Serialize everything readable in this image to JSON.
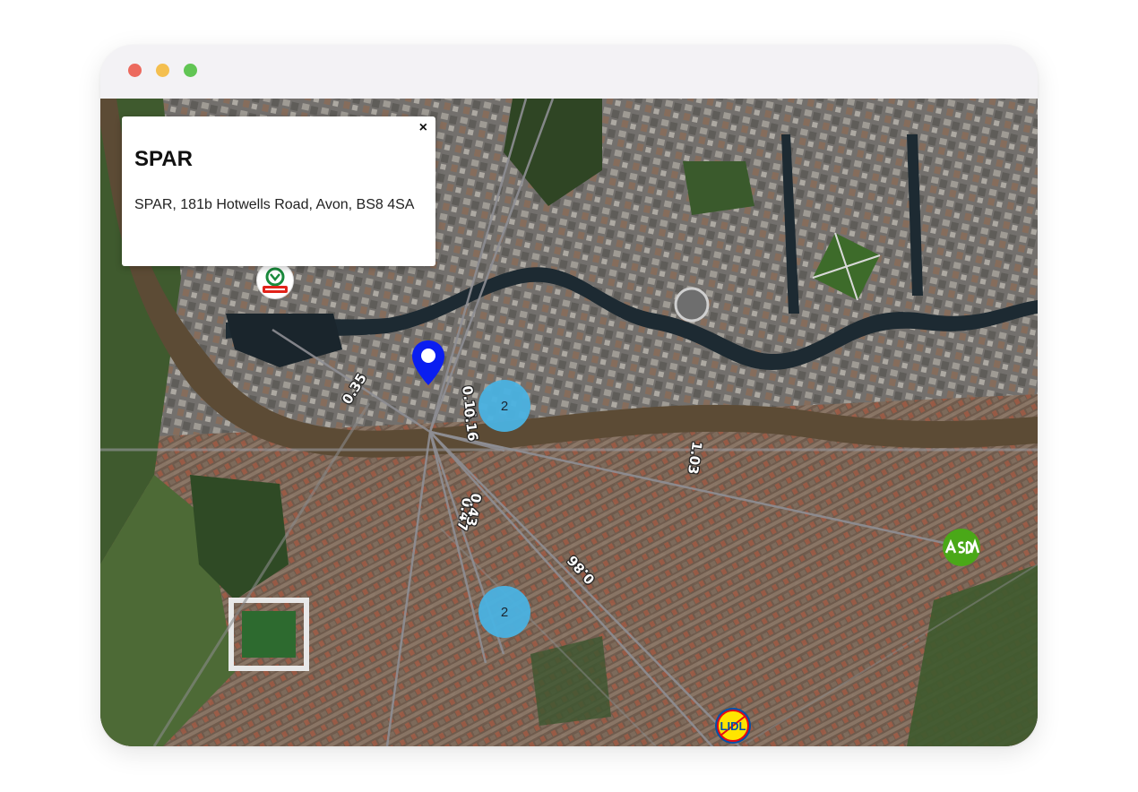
{
  "window": {
    "controls": [
      "close",
      "minimize",
      "maximize"
    ]
  },
  "popup": {
    "title": "SPAR",
    "address": "SPAR, 181b Hotwells Road, Avon, BS8 4SA",
    "close_symbol": "×"
  },
  "clusters": [
    {
      "count": "2"
    },
    {
      "count": "2"
    }
  ],
  "stores": [
    {
      "brand": "SPAR",
      "icon": "spar-logo-icon",
      "color": "#e2231a"
    },
    {
      "brand": "ASDA",
      "icon": "asda-logo-icon",
      "color": "#4aa818"
    },
    {
      "brand": "LIDL",
      "icon": "lidl-logo-icon",
      "color": "#0050aa"
    }
  ],
  "distance_labels": [
    "0.35",
    "0.14",
    "0.16",
    "1.03",
    "0.47",
    "0.43",
    "0.86"
  ],
  "colors": {
    "user_pin": "#0a1ef0",
    "cluster": "#4ab2e1",
    "route_line": "#8e8e93",
    "river": "#5c4b35"
  }
}
